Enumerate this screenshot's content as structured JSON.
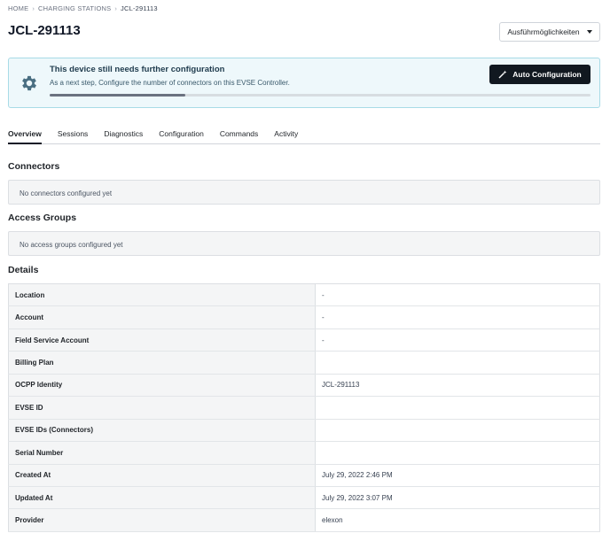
{
  "breadcrumb": [
    "HOME",
    "CHARGING STATIONS",
    "JCL-291113"
  ],
  "page_title": "JCL-291113",
  "actions_button": "Ausführmöglichkeiten",
  "banner": {
    "title": "This device still needs further configuration",
    "subtitle": "As a next step, Configure the number of connectors on this EVSE Controller.",
    "button": "Auto Configuration",
    "progress": 0.25
  },
  "tabs": [
    "Overview",
    "Sessions",
    "Diagnostics",
    "Configuration",
    "Commands",
    "Activity"
  ],
  "active_tab": "Overview",
  "connectors": {
    "title": "Connectors",
    "empty": "No connectors configured yet"
  },
  "access_groups": {
    "title": "Access Groups",
    "empty": "No access groups configured yet"
  },
  "details": {
    "title": "Details",
    "rows": [
      {
        "label": "Location",
        "value": "-"
      },
      {
        "label": "Account",
        "value": "-"
      },
      {
        "label": "Field Service Account",
        "value": "-"
      },
      {
        "label": "Billing Plan",
        "value": ""
      },
      {
        "label": "OCPP Identity",
        "value": "JCL-291113"
      },
      {
        "label": "EVSE ID",
        "value": ""
      },
      {
        "label": "EVSE IDs (Connectors)",
        "value": ""
      },
      {
        "label": "Serial Number",
        "value": ""
      },
      {
        "label": "Created At",
        "value": "July 29, 2022 2:46 PM"
      },
      {
        "label": "Updated At",
        "value": "July 29, 2022 3:07 PM"
      },
      {
        "label": "Provider",
        "value": "elexon"
      }
    ]
  },
  "colors": {
    "banner_bg": "#eef8fb",
    "banner_border": "#a8dbe6",
    "primary_button": "#111820",
    "gear": "#4a6f82"
  }
}
